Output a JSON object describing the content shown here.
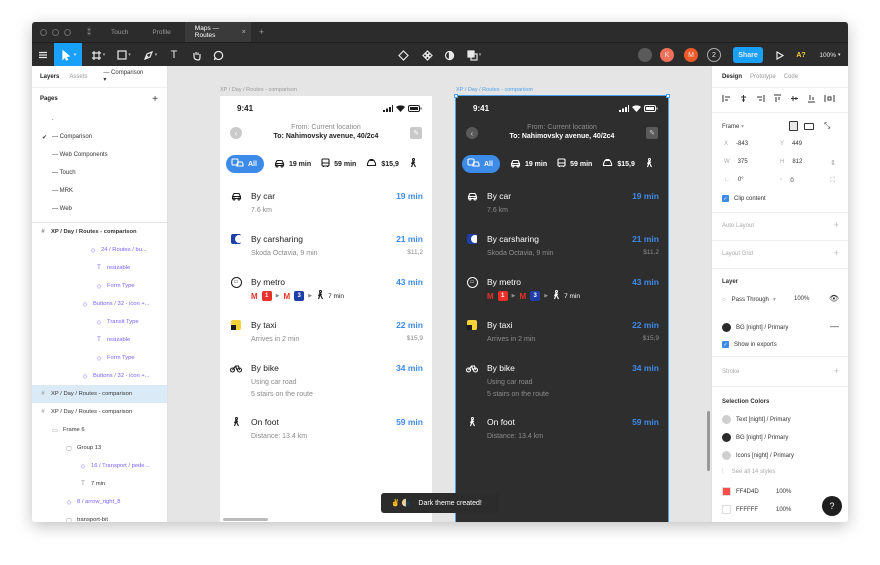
{
  "titlebar": {
    "tabs": [
      {
        "label": "Touch"
      },
      {
        "label": "Profile"
      },
      {
        "label": "Maps — Routes",
        "active": true
      }
    ],
    "add_tab": "+"
  },
  "toolbar": {
    "avatars": [
      {
        "letter": "",
        "color": "#5a5a5a"
      },
      {
        "letter": "K",
        "color": "#f0705a"
      },
      {
        "letter": "M",
        "color": "#f05a28"
      }
    ],
    "count": "2",
    "share_label": "Share",
    "aa_label": "A?",
    "zoom": "100%"
  },
  "left_panel": {
    "tabs": [
      "Layers",
      "Assets"
    ],
    "page_select": "— Comparison",
    "pages_heading": "Pages",
    "pages": [
      {
        "label": ".",
        "checked": false
      },
      {
        "label": "— Comparison",
        "checked": true
      },
      {
        "label": "— Web Components",
        "checked": false
      },
      {
        "label": "— Touch",
        "checked": false
      },
      {
        "label": "— MRK",
        "checked": false
      },
      {
        "label": "— Web",
        "checked": false
      }
    ],
    "layers": [
      {
        "label": "XP / Day / Routes - comparison",
        "icon": "#",
        "indent": 6,
        "type": "frame",
        "bold": true
      },
      {
        "label": "24 / Routes / bu...",
        "icon": "◇",
        "indent": 56,
        "type": "comp"
      },
      {
        "label": "resizable",
        "icon": "T",
        "indent": 62,
        "type": "comp"
      },
      {
        "label": "Form Type",
        "icon": "◇",
        "indent": 62,
        "type": "comp"
      },
      {
        "label": "Buttons / 32 - icon +...",
        "icon": "◇",
        "indent": 48,
        "type": "comp"
      },
      {
        "label": "Transit Type",
        "icon": "◇",
        "indent": 62,
        "type": "comp"
      },
      {
        "label": "resizable",
        "icon": "T",
        "indent": 62,
        "type": "comp"
      },
      {
        "label": "Form Type",
        "icon": "◇",
        "indent": 62,
        "type": "comp"
      },
      {
        "label": "Buttons / 32 - icon +...",
        "icon": "◇",
        "indent": 48,
        "type": "comp"
      },
      {
        "label": "XP / Day / Routes - comparison",
        "icon": "#",
        "indent": 6,
        "type": "frame",
        "selected": true
      },
      {
        "label": "XP / Day / Routes - comparison",
        "icon": "#",
        "indent": 6,
        "type": "frame"
      },
      {
        "label": "Frame 6",
        "icon": "▭",
        "indent": 18,
        "type": "frame"
      },
      {
        "label": "Group 13",
        "icon": "▢",
        "indent": 32,
        "type": "frame"
      },
      {
        "label": "16 / Transport / pede...",
        "icon": "◇",
        "indent": 46,
        "type": "comp"
      },
      {
        "label": "7 min",
        "icon": "T",
        "indent": 46,
        "type": "frame"
      },
      {
        "label": "8 / arrow_right_8",
        "icon": "◇",
        "indent": 32,
        "type": "comp"
      },
      {
        "label": "transport-bit",
        "icon": "▢",
        "indent": 32,
        "type": "frame"
      },
      {
        "label": "8 / arrow_right_8",
        "icon": "◇",
        "indent": 32,
        "type": "comp"
      }
    ]
  },
  "canvas": {
    "light_label": "XP / Day / Routes - comparison",
    "dark_label": "XP / Day / Routes - comparison",
    "toast_text": "Dark theme created!",
    "toast_emoji": "✌️ 🌗"
  },
  "phone": {
    "time": "9:41",
    "from": "From: Current location",
    "to": "To: Nahimovsky avenue, 40/2c4",
    "modes": [
      {
        "icon": "car-bus-icon",
        "label": "All"
      },
      {
        "icon": "car-icon",
        "label": "19 min"
      },
      {
        "icon": "bus-icon",
        "label": "59 min"
      },
      {
        "icon": "taxi-icon",
        "label": "$15,9"
      },
      {
        "icon": "walk-icon",
        "label": ""
      }
    ],
    "routes": [
      {
        "name": "By car",
        "time": "19 min",
        "sub": [
          "7.6 km"
        ],
        "price": "",
        "icon": "car-icon"
      },
      {
        "name": "By carsharing",
        "time": "21 min",
        "sub": [
          "Skoda Octavia, 9 min"
        ],
        "price": "$11,2",
        "icon": "carsharing-icon"
      },
      {
        "name": "By metro",
        "time": "43 min",
        "sub": [],
        "price": "",
        "icon": "metro-icon",
        "metro": {
          "line1": "1",
          "line2": "3",
          "walk": "7 min"
        }
      },
      {
        "name": "By taxi",
        "time": "22 min",
        "sub": [
          "Arrives in 2 min"
        ],
        "price": "$15,9",
        "icon": "taxi-icon"
      },
      {
        "name": "By bike",
        "time": "34 min",
        "sub": [
          "Using car road",
          "5 stairs on the route"
        ],
        "price": "",
        "icon": "bike-icon"
      },
      {
        "name": "On foot",
        "time": "59 min",
        "sub": [
          "Distance: 13.4 km"
        ],
        "price": "",
        "icon": "walk-icon"
      }
    ]
  },
  "right_panel": {
    "tabs": [
      "Design",
      "Prototype",
      "Code"
    ],
    "frame_label": "Frame",
    "x": "-843",
    "y": "449",
    "w": "375",
    "h": "812",
    "rotation": "0°",
    "radius": "0",
    "clip_content": "Clip content",
    "auto_layout": "Auto Layout",
    "layout_grid": "Layout Grid",
    "layer_heading": "Layer",
    "blend": "Pass Through",
    "opacity": "100%",
    "fill_style": "BG [night] / Primary",
    "show_exports": "Show in exports",
    "stroke": "Stroke",
    "selection_colors": "Selection Colors",
    "colors": [
      {
        "label": "Text [night] / Primary",
        "color": "#cfcfcf",
        "round": true
      },
      {
        "label": "BG [night] / Primary",
        "color": "#2a2a2a",
        "round": true
      },
      {
        "label": "Icons [night] / Primary",
        "color": "#cfcfcf",
        "round": true
      }
    ],
    "see_all": "See all 14 styles",
    "hex_colors": [
      {
        "hex": "FF4D4D",
        "opacity": "100%",
        "color": "#ff4d4d"
      },
      {
        "hex": "FFFFFF",
        "opacity": "100%",
        "color": "#ffffff"
      }
    ]
  },
  "colors": {
    "accent": "#3d8be8",
    "figma_blue": "#18a0fb",
    "metro_red": "#e8302a",
    "metro_blue": "#1e3fa8"
  }
}
